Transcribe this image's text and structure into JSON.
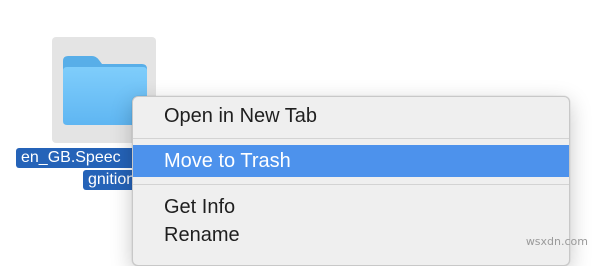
{
  "file": {
    "name_line_1": "en_GB.Speec",
    "name_line_2": "gnition",
    "icon": "folder-icon"
  },
  "context_menu": {
    "items": [
      {
        "label": "Open in New Tab",
        "selected": false
      },
      {
        "label": "Move to Trash",
        "selected": true
      },
      {
        "label": "Get Info",
        "selected": false
      },
      {
        "label": "Rename",
        "selected": false
      }
    ]
  },
  "watermark": "wsxdn.com",
  "colors": {
    "selection": "#4d92ec",
    "label_selection": "#2563b8",
    "folder": "#6cc0f7",
    "menu_background": "#efefef"
  }
}
